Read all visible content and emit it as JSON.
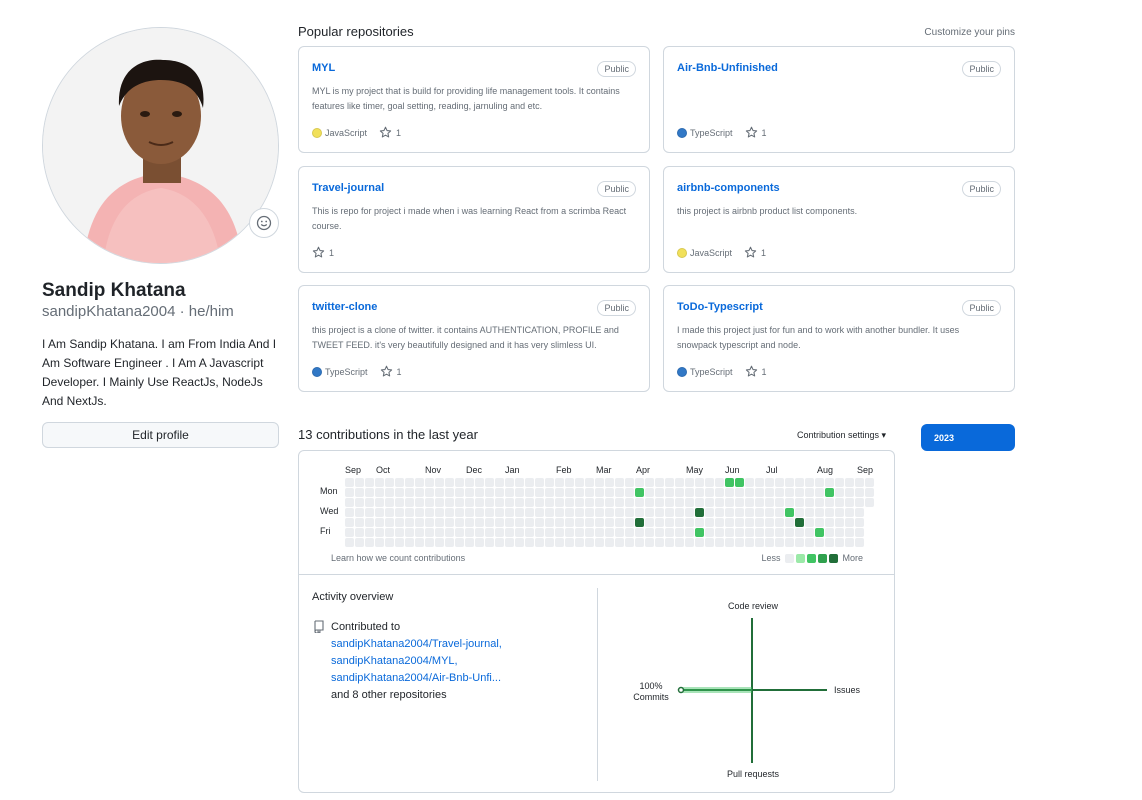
{
  "profile": {
    "name": "Sandip Khatana",
    "handle": "sandipKhatana2004 · he/him",
    "bio": "I Am Sandip Khatana. I am From India And I Am Software Engineer . I Am A Javascript Developer. I Mainly Use ReactJs, NodeJs And NextJs.",
    "edit_label": "Edit profile"
  },
  "pinned": {
    "title": "Popular repositories",
    "customize_label": "Customize your pins",
    "repos": [
      {
        "name": "MYL",
        "visibility": "Public",
        "description": "MYL is my project that is build for providing life management tools. It contains features like timer, goal setting, reading, jarnuling and etc.",
        "language": "JavaScript",
        "language_color": "#f1e05a",
        "stars": "1"
      },
      {
        "name": "Air-Bnb-Unfinished",
        "visibility": "Public",
        "description": "",
        "language": "TypeScript",
        "language_color": "#3178c6",
        "stars": "1"
      },
      {
        "name": "Travel-journal",
        "visibility": "Public",
        "description": "This is repo for project i made when i was learning React from a scrimba React course.",
        "language": "",
        "language_color": "",
        "stars": "1"
      },
      {
        "name": "airbnb-components",
        "visibility": "Public",
        "description": "this project is airbnb product list components.",
        "language": "JavaScript",
        "language_color": "#f1e05a",
        "stars": "1"
      },
      {
        "name": "twitter-clone",
        "visibility": "Public",
        "description": "this project is a clone of twitter. it contains AUTHENTICATION, PROFILE and TWEET FEED. it's very beautifully designed and it has very slimless UI.",
        "language": "TypeScript",
        "language_color": "#3178c6",
        "stars": "1"
      },
      {
        "name": "ToDo-Typescript",
        "visibility": "Public",
        "description": "I made this project just for fun and to work with another bundler. It uses snowpack typescript and node.",
        "language": "TypeScript",
        "language_color": "#3178c6",
        "stars": "1"
      }
    ]
  },
  "contributions": {
    "title": "13 contributions in the last year",
    "settings_label": "Contribution settings ▾",
    "year": "2023",
    "months": [
      "Sep",
      "Oct",
      "Nov",
      "Dec",
      "Jan",
      "Feb",
      "Mar",
      "Apr",
      "May",
      "Jun",
      "Jul",
      "Aug",
      "Sep"
    ],
    "days": [
      "Mon",
      "Wed",
      "Fri"
    ],
    "learn_label": "Learn how we count contributions",
    "legend_less": "Less",
    "legend_more": "More",
    "level_colors": [
      "#ebedf0",
      "#9be9a8",
      "#40c463",
      "#30a14e",
      "#216e39"
    ],
    "active_days": [
      {
        "week": 29,
        "weekday": 1,
        "level": 2
      },
      {
        "week": 29,
        "weekday": 4,
        "level": 4
      },
      {
        "week": 35,
        "weekday": 3,
        "level": 4
      },
      {
        "week": 35,
        "weekday": 5,
        "level": 2
      },
      {
        "week": 38,
        "weekday": 0,
        "level": 2
      },
      {
        "week": 39,
        "weekday": 0,
        "level": 2
      },
      {
        "week": 44,
        "weekday": 3,
        "level": 2
      },
      {
        "week": 45,
        "weekday": 4,
        "level": 4
      },
      {
        "week": 47,
        "weekday": 5,
        "level": 2
      },
      {
        "week": 48,
        "weekday": 1,
        "level": 2
      }
    ]
  },
  "activity": {
    "title": "Activity overview",
    "contributed_to": "Contributed to",
    "repos": [
      "sandipKhatana2004/Travel-journal,",
      "sandipKhatana2004/MYL,",
      "sandipKhatana2004/Air-Bnb-Unfi..."
    ],
    "others": "and 8 other repositories",
    "axes": {
      "top": "Code review",
      "bottom": "Pull requests",
      "right": "Issues",
      "left_percent": "100%",
      "left_label": "Commits"
    },
    "commits_share_percent": 100
  }
}
